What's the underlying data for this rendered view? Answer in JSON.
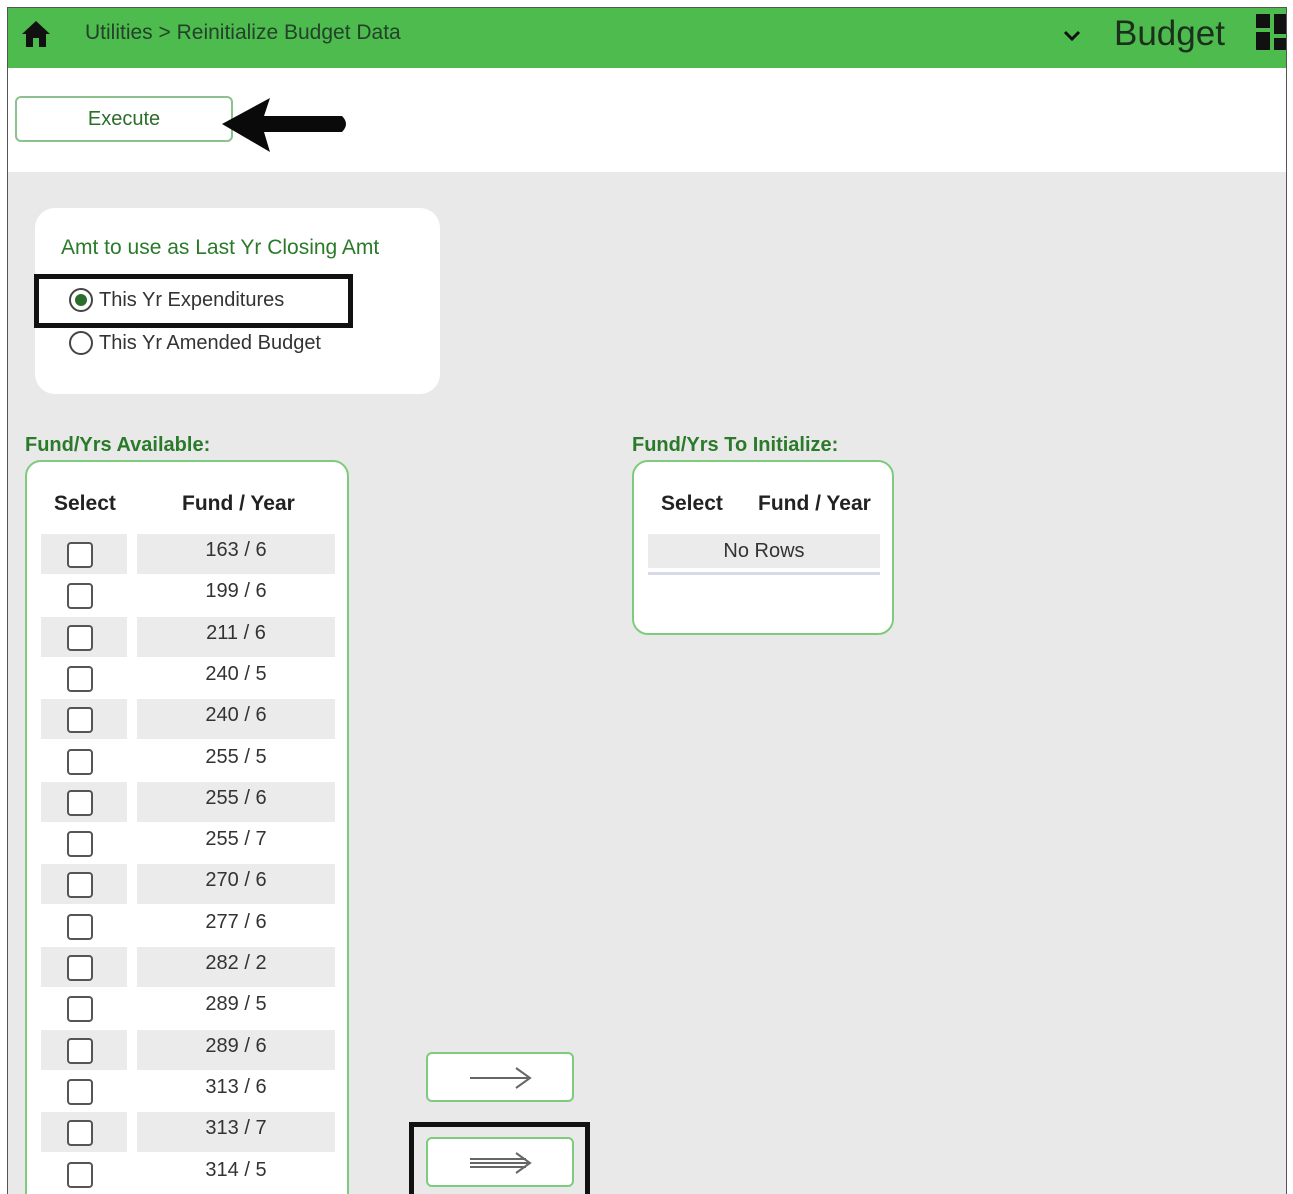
{
  "header": {
    "breadcrumb": "Utilities > Reinitialize Budget Data",
    "app_title": "Budget",
    "bg_color": "#4dbb4d"
  },
  "icons": {
    "home": "home-icon",
    "dropdown": "chevron-down-icon",
    "apps": "grid-icon",
    "callout": "arrow-left-icon",
    "move_selected": "arrow-right-icon",
    "move_all": "double-arrow-right-icon"
  },
  "toolbar": {
    "execute_label": "Execute"
  },
  "amount_option": {
    "title": "Amt to use as Last Yr Closing Amt",
    "options": [
      {
        "label": "This Yr Expenditures",
        "checked": true
      },
      {
        "label": "This Yr Amended Budget",
        "checked": false
      }
    ]
  },
  "available": {
    "label": "Fund/Yrs Available:",
    "col_select": "Select",
    "col_fund_year": "Fund / Year",
    "rows": [
      "163 / 6",
      "199 / 6",
      "211 / 6",
      "240 / 5",
      "240 / 6",
      "255 / 5",
      "255 / 6",
      "255 / 7",
      "270 / 6",
      "277 / 6",
      "282 / 2",
      "289 / 5",
      "289 / 6",
      "313 / 6",
      "313 / 7",
      "314 / 5"
    ]
  },
  "to_initialize": {
    "label": "Fund/Yrs To Initialize:",
    "col_select": "Select",
    "col_fund_year": "Fund / Year",
    "empty_text": "No Rows"
  }
}
